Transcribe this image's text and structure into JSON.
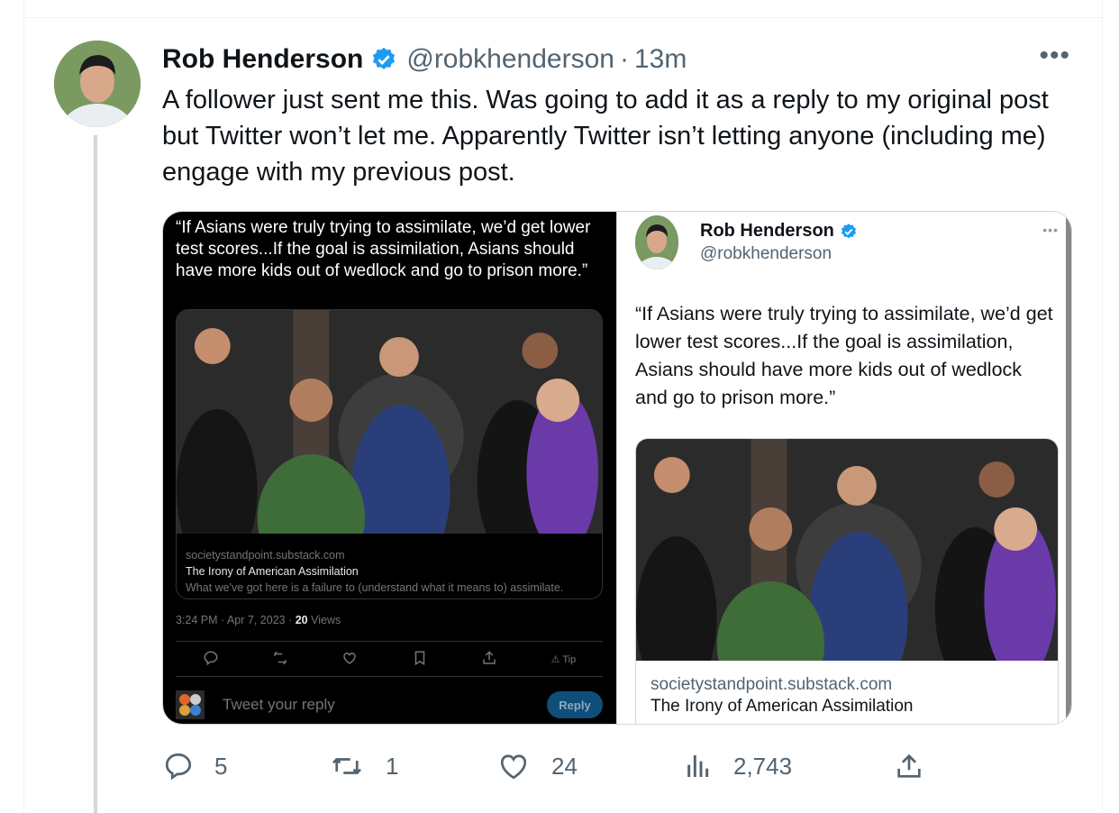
{
  "tweet": {
    "name": "Rob Henderson",
    "handle": "@robkhenderson",
    "separator": "·",
    "time": "13m",
    "more": "•••",
    "text": "A follower just sent me this. Was going to add it as a reply to my original post but Twitter won’t let me. Apparently Twitter isn’t letting anyone (including me) engage with my previous post."
  },
  "dark_screenshot": {
    "quote": "“If Asians were truly trying to assimilate, we’d get lower test scores...If the goal is assimilation, Asians should have more kids out of wedlock and go to prison more.”",
    "card_domain": "societystandpoint.substack.com",
    "card_title": "The Irony of American Assimilation",
    "card_desc": "What we've got here is a failure to (understand what it means to) assimilate.",
    "meta_time": "3:24 PM · Apr 7, 2023 · ",
    "meta_views_count": "20",
    "meta_views_label": " Views",
    "tip_label": "Tip",
    "reply_placeholder": "Tweet your reply",
    "reply_button": "Reply"
  },
  "light_screenshot": {
    "name": "Rob Henderson",
    "handle": "@robkhenderson",
    "more": "•••",
    "quote": "“If Asians were truly trying to assimilate, we’d get lower test scores...If the goal is assimilation, Asians should have more kids out of wedlock and go to prison more.”",
    "card_domain": "societystandpoint.substack.com",
    "card_title": "The Irony of American Assimilation"
  },
  "actions": {
    "replies": "5",
    "retweets": "1",
    "likes": "24",
    "views": "2,743"
  },
  "colors": {
    "verified": "#1d9bf0",
    "secondary_text": "#536471",
    "reply_button": "#0f4e7a"
  }
}
